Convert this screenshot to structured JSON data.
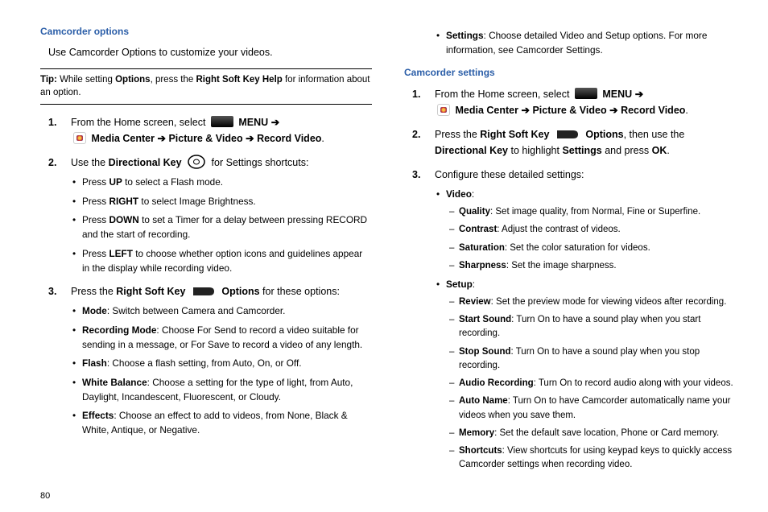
{
  "pageNumber": "80",
  "left": {
    "heading": "Camcorder options",
    "intro": "Use Camcorder Options to customize your videos.",
    "tip": {
      "label": "Tip:",
      "part1": " While setting ",
      "b1": "Options",
      "part2": ", press the ",
      "b2": "Right Soft Key Help",
      "part3": " for information about an option."
    },
    "steps": [
      {
        "num": "1.",
        "t1": "From the Home screen, select",
        "menu": "MENU",
        "arrow1": "➔",
        "bMedia": "Media Center",
        "arrow2": "➔",
        "bPic": "Picture & Video",
        "arrow3": "➔",
        "bRec": "Record Video",
        "dot": "."
      },
      {
        "num": "2.",
        "t1": "Use the ",
        "b1": "Directional Key",
        "t2": " for Settings shortcuts:",
        "bullets": [
          {
            "pre": "Press ",
            "b": "UP",
            "post": " to select a Flash mode."
          },
          {
            "pre": "Press ",
            "b": "RIGHT",
            "post": " to select Image Brightness."
          },
          {
            "pre": "Press ",
            "b": "DOWN",
            "post": " to set a Timer for a delay between pressing RECORD and the start of recording."
          },
          {
            "pre": "Press ",
            "b": "LEFT",
            "post": " to choose whether option icons and guidelines appear in the display while recording video."
          }
        ]
      },
      {
        "num": "3.",
        "t1": "Press the ",
        "b1": "Right Soft Key",
        "b2": "Options",
        "t2": " for these options:",
        "bullets": [
          {
            "b": "Mode",
            "post": ": Switch between Camera and Camcorder."
          },
          {
            "b": "Recording Mode",
            "post": ": Choose For Send to record a video suitable for sending in a message, or For Save to record a video of any length."
          },
          {
            "b": "Flash",
            "post": ": Choose a flash setting, from Auto, On, or Off."
          },
          {
            "b": "White Balance",
            "post": ": Choose a setting for the type of light, from Auto, Daylight, Incandescent, Fluorescent, or Cloudy."
          },
          {
            "b": "Effects",
            "post": ": Choose an effect to add to videos, from None, Black & White, Antique, or Negative."
          }
        ]
      }
    ]
  },
  "right": {
    "topBullet": {
      "b": "Settings",
      "post": ": Choose detailed Video and Setup options. For more information, see Camcorder Settings."
    },
    "heading": "Camcorder settings",
    "steps": [
      {
        "num": "1.",
        "t1": "From the Home screen, select",
        "menu": "MENU",
        "arrow1": "➔",
        "bMedia": "Media Center",
        "arrow2": "➔",
        "bPic": "Picture & Video",
        "arrow3": "➔",
        "bRec": "Record Video",
        "dot": "."
      },
      {
        "num": "2.",
        "t1": "Press the ",
        "b1": "Right Soft Key",
        "b2": "Options",
        "t2": ", then use the ",
        "b3": "Directional Key",
        "t3": " to highlight ",
        "b4": "Settings",
        "t4": " and press ",
        "b5": "OK",
        "dot": "."
      },
      {
        "num": "3.",
        "t1": "Configure these detailed settings:",
        "groups": [
          {
            "b": "Video",
            "subs": [
              {
                "b": "Quality",
                "post": ": Set image quality, from Normal, Fine or Superfine."
              },
              {
                "b": "Contrast",
                "post": ": Adjust the contrast of videos."
              },
              {
                "b": "Saturation",
                "post": ": Set the color saturation for videos."
              },
              {
                "b": "Sharpness",
                "post": ": Set the image sharpness."
              }
            ]
          },
          {
            "b": "Setup",
            "subs": [
              {
                "b": "Review",
                "post": ": Set the preview mode for viewing videos after recording."
              },
              {
                "b": "Start Sound",
                "post": ": Turn On to have a sound play when you start recording."
              },
              {
                "b": "Stop Sound",
                "post": ": Turn On to have a sound play when you stop recording."
              },
              {
                "b": "Audio Recording",
                "post": ": Turn On to record audio along with your videos."
              },
              {
                "b": "Auto Name",
                "post": ": Turn On to have Camcorder automatically name your videos when you save them."
              },
              {
                "b": "Memory",
                "post": ": Set the default save location, Phone or Card memory."
              },
              {
                "b": "Shortcuts",
                "post": ": View shortcuts for using keypad keys to quickly access Camcorder settings when recording video."
              }
            ]
          }
        ]
      }
    ]
  }
}
